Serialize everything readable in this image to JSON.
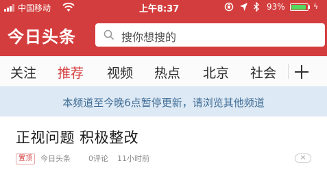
{
  "status_bar": {
    "carrier": "中国移动",
    "time": "上午8:37",
    "battery_percent": "93%",
    "battery_level": 0.93,
    "icons": [
      "signal-icon",
      "wifi-icon",
      "lock-rotation-icon",
      "location-icon",
      "bluetooth-icon",
      "battery-icon",
      "charging-icon"
    ]
  },
  "header": {
    "logo": "今日头条",
    "search_placeholder": "搜你想搜的"
  },
  "tabs": [
    {
      "label": "关注",
      "active": false
    },
    {
      "label": "推荐",
      "active": true
    },
    {
      "label": "视频",
      "active": false
    },
    {
      "label": "热点",
      "active": false
    },
    {
      "label": "北京",
      "active": false
    },
    {
      "label": "社会",
      "active": false
    }
  ],
  "notice": "本频道至今晚6点暂停更新，请浏览其他频道",
  "article": {
    "title": "正视问题 积极整改",
    "pin_label": "置顶",
    "source": "今日头条",
    "comments": "0评论",
    "time": "11小时前"
  },
  "colors": {
    "brand_red": "#d43d3d",
    "notice_bg": "#dde9f4",
    "notice_text": "#3f6c96",
    "battery_green": "#54d85f"
  }
}
